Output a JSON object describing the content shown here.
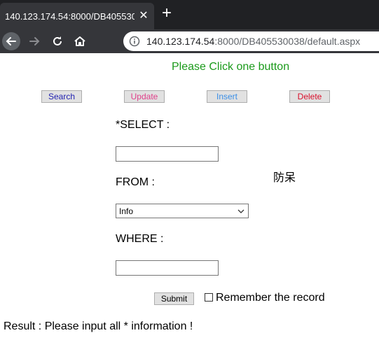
{
  "browser": {
    "tab_title": "140.123.174.54:8000/DB405530038/default.aspx",
    "close_glyph": "✕",
    "new_tab_glyph": "+",
    "url_host": "140.123.174.54",
    "url_path": ":8000/DB405530038/default.aspx",
    "icons": [
      "back-icon",
      "forward-icon",
      "reload-icon",
      "home-icon",
      "info-icon"
    ]
  },
  "page": {
    "heading": "Please Click one button",
    "buttons": [
      {
        "label": "Search",
        "color": "#1f1fb0"
      },
      {
        "label": "Update",
        "color": "#e0408a"
      },
      {
        "label": "Insert",
        "color": "#3a8ee6"
      },
      {
        "label": "Delete",
        "color": "#d8102c"
      }
    ],
    "select_label": "*SELECT :",
    "select_value": "",
    "from_label": "FROM :",
    "from_selected": "Info",
    "where_label": "WHERE :",
    "where_value": "",
    "side_text": "防呆",
    "submit_label": "Submit",
    "remember_label": "Remember the record",
    "remember_checked": false,
    "result": "Result : Please input all * information !",
    "heading_color": "#1a9a1a"
  }
}
